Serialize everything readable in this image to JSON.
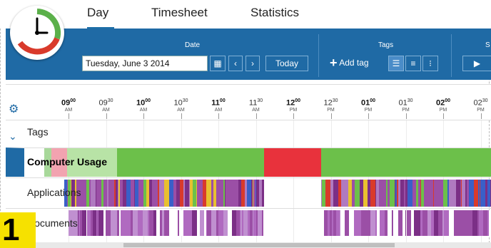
{
  "tabs": {
    "day": "Day",
    "timesheet": "Timesheet",
    "statistics": "Statistics"
  },
  "ribbon": {
    "date_group_label": "Date",
    "date_value": "Tuesday, June 3 2014",
    "today_label": "Today",
    "tags_group_label": "Tags",
    "add_tag_label": "Add tag",
    "next_group_label_partial": "S"
  },
  "timeline": {
    "ticks": [
      {
        "h": "09",
        "m": "00",
        "ap": "AM",
        "major": true
      },
      {
        "h": "09",
        "m": "30",
        "ap": "AM",
        "major": false
      },
      {
        "h": "10",
        "m": "00",
        "ap": "AM",
        "major": true
      },
      {
        "h": "10",
        "m": "30",
        "ap": "AM",
        "major": false
      },
      {
        "h": "11",
        "m": "00",
        "ap": "AM",
        "major": true
      },
      {
        "h": "11",
        "m": "30",
        "ap": "AM",
        "major": false
      },
      {
        "h": "12",
        "m": "00",
        "ap": "PM",
        "major": true
      },
      {
        "h": "12",
        "m": "30",
        "ap": "PM",
        "major": false
      },
      {
        "h": "01",
        "m": "00",
        "ap": "PM",
        "major": true
      },
      {
        "h": "01",
        "m": "30",
        "ap": "PM",
        "major": false
      },
      {
        "h": "02",
        "m": "00",
        "ap": "PM",
        "major": true
      },
      {
        "h": "02",
        "m": "30",
        "ap": "PM",
        "major": false
      }
    ]
  },
  "rows": {
    "tags": "Tags",
    "computer_usage": "Computer Usage",
    "applications": "Applications",
    "documents": "Documents"
  },
  "badge": "1",
  "colors": {
    "accent": "#1f6aa5",
    "active_green": "#6cc04a",
    "idle_red": "#e8323c",
    "purple": "#9b4fa6"
  }
}
